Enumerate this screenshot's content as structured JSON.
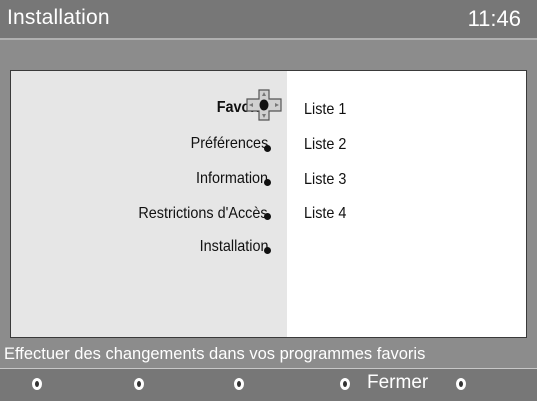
{
  "header": {
    "title": "Installation",
    "clock": "11:46"
  },
  "menu": {
    "items": [
      {
        "label": "Favoris",
        "selected": true
      },
      {
        "label": "Préférences",
        "selected": false
      },
      {
        "label": "Information",
        "selected": false
      },
      {
        "label": "Restrictions d'Accès",
        "selected": false
      },
      {
        "label": "Installation",
        "selected": false
      }
    ]
  },
  "submenu": {
    "items": [
      "Liste 1",
      "Liste 2",
      "Liste 3",
      "Liste 4"
    ]
  },
  "status": {
    "help_text": "Effectuer des changements dans vos programmes favoris"
  },
  "footer": {
    "close_label": "Fermer"
  },
  "icons": {
    "navigation": "dpad-icon",
    "menu_marker": "bullet-dot-icon",
    "color_key": "color-key-button-icon"
  },
  "colors": {
    "header_bg": "#777777",
    "body_bg": "#8c8c8c",
    "panel_left": "#e6e6e6",
    "panel_right": "#ffffff"
  }
}
